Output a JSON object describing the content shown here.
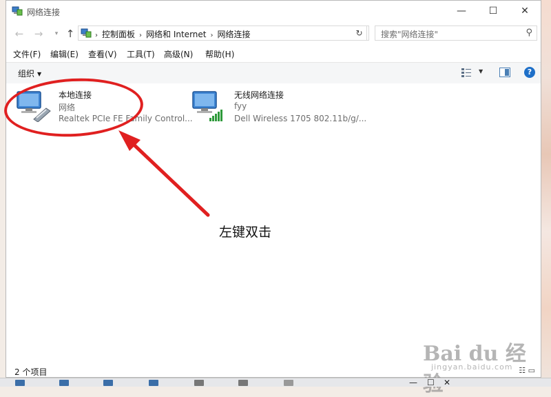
{
  "window": {
    "title": "网络连接",
    "controls": {
      "minimize": "—",
      "maximize": "☐",
      "close": "✕"
    }
  },
  "nav": {
    "back": "←",
    "forward": "→",
    "recent": "▾",
    "up": "↑",
    "refresh": "↻"
  },
  "address": {
    "breadcrumbs": [
      "控制面板",
      "网络和 Internet",
      "网络连接"
    ],
    "separator": "›",
    "dropdown": "⌄"
  },
  "search": {
    "placeholder": "搜索\"网络连接\""
  },
  "menu": {
    "items": [
      "文件(F)",
      "编辑(E)",
      "查看(V)",
      "工具(T)",
      "高级(N)",
      "帮助(H)"
    ]
  },
  "toolbar": {
    "organize": "组织",
    "help": "?"
  },
  "connections": [
    {
      "name": "本地连接",
      "status": "网络",
      "device": "Realtek PCIe FE Family Control...",
      "icon": "ethernet-adapter-icon"
    },
    {
      "name": "无线网络连接",
      "status": "fyy",
      "device": "Dell Wireless 1705 802.11b/g/...",
      "icon": "wireless-adapter-icon"
    }
  ],
  "annotation": {
    "text": "左键双击",
    "color": "#e02020"
  },
  "statusbar": {
    "count": "2 个项目"
  },
  "watermark": {
    "main": "Bai du 经验",
    "sub": "jingyan.baidu.com"
  },
  "colors": {
    "accent": "#1e6fc8",
    "annotation": "#e02020"
  }
}
